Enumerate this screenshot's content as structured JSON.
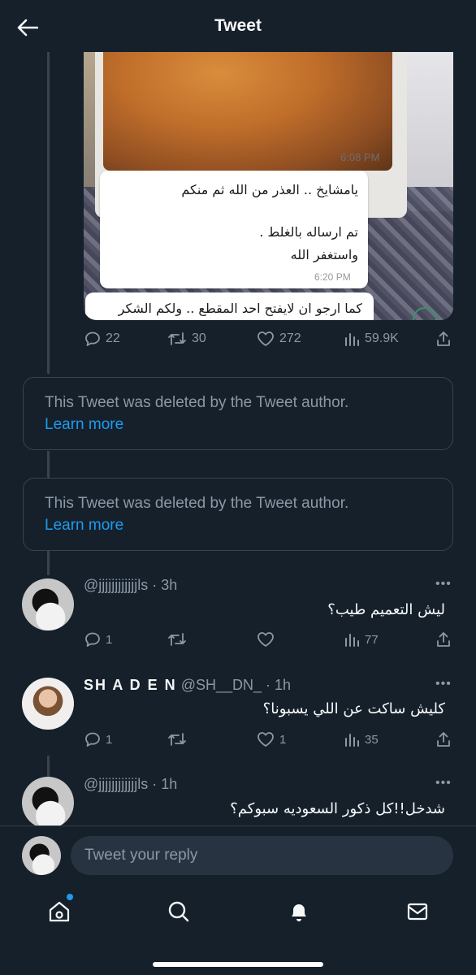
{
  "header": {
    "title": "Tweet"
  },
  "media": {
    "time_1": "6:08 PM",
    "time_2": "6:20 PM",
    "bubble_line_1": "يامشايخ .. العذر من الله ثم منكم",
    "bubble_line_2": "تم ارساله بالغلط .",
    "bubble_line_3": "واستغفر الله",
    "bubble2_line": "كما ارجو ان لايفتح احد المقطع .. ولكم الشكر"
  },
  "main_tweet_actions": {
    "replies": "22",
    "retweets": "30",
    "likes": "272",
    "views": "59.9K"
  },
  "deleted": [
    {
      "text": "This Tweet was deleted by the Tweet author.",
      "link": "Learn more"
    },
    {
      "text": "This Tweet was deleted by the Tweet author.",
      "link": "Learn more"
    }
  ],
  "replies": [
    {
      "name": "",
      "handle": "@jjjjjjjjjjjjls",
      "time": "3h",
      "text": "ليش التعميم طيب؟",
      "replies": "1",
      "retweets": "",
      "likes": "",
      "views": "77"
    },
    {
      "name": "SH A D E N",
      "handle": "@SH__DN_",
      "time": "1h",
      "text": "كليش ساكت عن اللي يسبونا؟",
      "replies": "1",
      "retweets": "",
      "likes": "1",
      "views": "35"
    },
    {
      "name": "",
      "handle": "@jjjjjjjjjjjjls",
      "time": "1h",
      "text": "شدخل!!كل ذكور السعوديه سبوكم؟"
    }
  ],
  "composer": {
    "placeholder": "Tweet your reply"
  },
  "icons": [
    "back-arrow-icon",
    "reply-icon",
    "retweet-icon",
    "like-icon",
    "views-icon",
    "share-icon",
    "more-icon",
    "home-icon",
    "search-icon",
    "bell-icon",
    "mail-icon"
  ],
  "colors": {
    "background": "#15202b",
    "accent": "#1d9bf0",
    "muted": "#8b98a5",
    "border": "#38444d"
  }
}
